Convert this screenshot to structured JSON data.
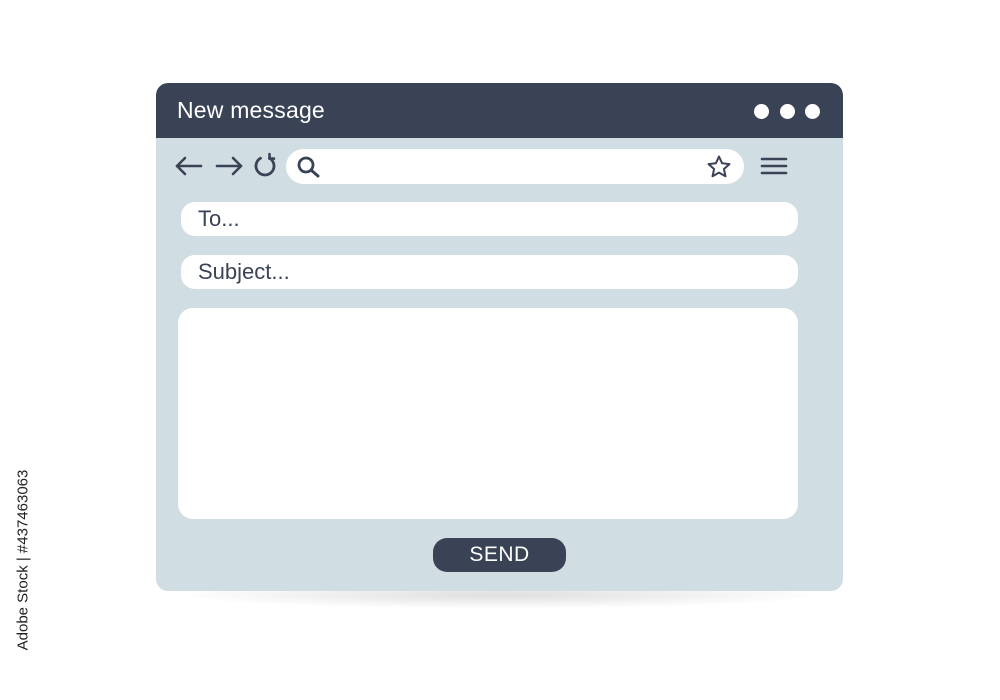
{
  "window": {
    "title": "New message"
  },
  "toolbar": {
    "back_icon": "arrow-left-icon",
    "forward_icon": "arrow-right-icon",
    "reload_icon": "reload-icon",
    "search_icon": "search-icon",
    "bookmark_icon": "star-icon",
    "menu_icon": "hamburger-menu-icon",
    "url_value": ""
  },
  "compose": {
    "to_placeholder": "To...",
    "subject_placeholder": "Subject...",
    "body_value": "",
    "send_label": "SEND"
  },
  "watermark": {
    "text": "Adobe Stock | #437463063"
  },
  "colors": {
    "titlebar": "#3a4355",
    "window_bg": "#d0dee4",
    "field_bg": "#ffffff",
    "accent": "#3a4355"
  }
}
